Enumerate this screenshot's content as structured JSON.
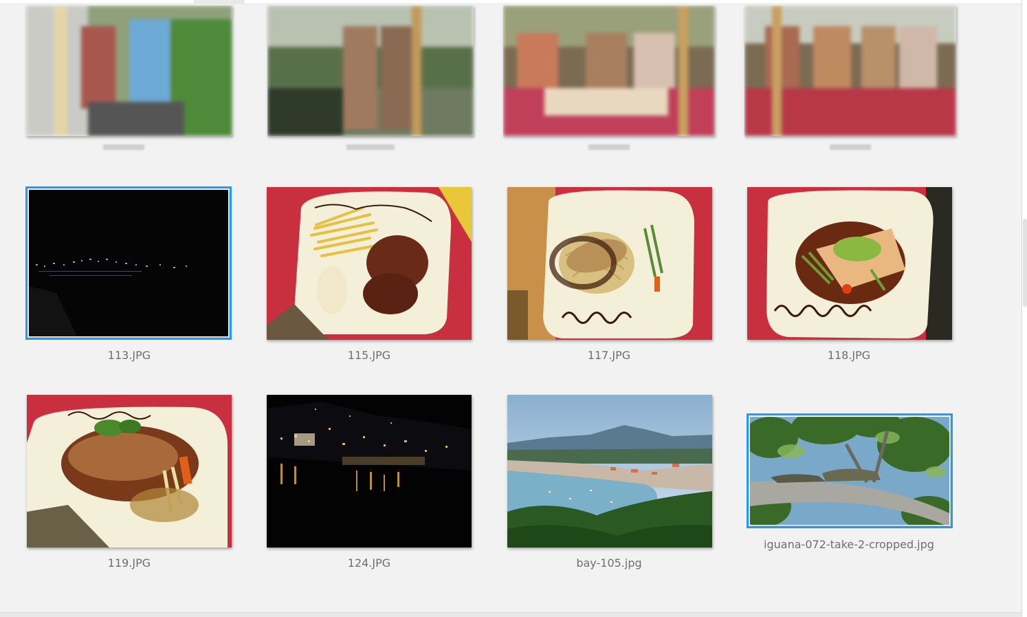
{
  "gallery": {
    "rows": [
      {
        "items": [
          {
            "filename": "",
            "redacted": true,
            "selected": false,
            "scene": "people-railing"
          },
          {
            "filename": "",
            "redacted": true,
            "selected": false,
            "scene": "people-viewpoint"
          },
          {
            "filename": "",
            "redacted": true,
            "selected": false,
            "scene": "people-dinner"
          },
          {
            "filename": "",
            "redacted": true,
            "selected": false,
            "scene": "people-dinner"
          }
        ]
      },
      {
        "items": [
          {
            "filename": "113.JPG",
            "selected": true,
            "scene": "night-coast"
          },
          {
            "filename": "115.JPG",
            "selected": false,
            "scene": "plate-fries-steak"
          },
          {
            "filename": "117.JPG",
            "selected": false,
            "scene": "plate-pasta-fish"
          },
          {
            "filename": "118.JPG",
            "selected": false,
            "scene": "plate-fish-veg"
          }
        ]
      },
      {
        "items": [
          {
            "filename": "119.JPG",
            "selected": false,
            "scene": "plate-chicken"
          },
          {
            "filename": "124.JPG",
            "selected": false,
            "scene": "night-harbor"
          },
          {
            "filename": "bay-105.jpg",
            "selected": false,
            "scene": "bay-view"
          },
          {
            "filename": "iguana-072-take-2-cropped.jpg",
            "selected": true,
            "scene": "iguanas-branch"
          }
        ]
      }
    ]
  },
  "colors": {
    "background": "#f2f2f2",
    "selection_outline": "#1e9bff",
    "caption_text": "#6e6e6e"
  }
}
